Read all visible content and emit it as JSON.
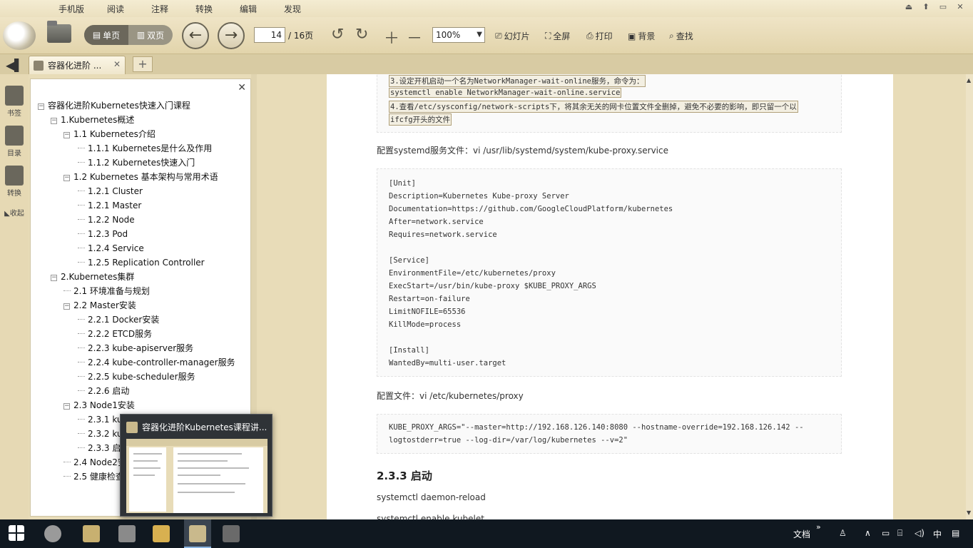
{
  "menu": [
    "手机版",
    "阅读",
    "注释",
    "转换",
    "编辑",
    "发现"
  ],
  "window_controls": [
    "⏏",
    "⬆",
    "▭",
    "✕"
  ],
  "toolbar": {
    "single_page": "单页",
    "double_page": "双页",
    "page_current": "14",
    "page_total": "/ 16页",
    "zoom": "100%",
    "slideshow": "幻灯片",
    "fullscreen": "全屏",
    "print": "打印",
    "background": "背景",
    "find": "查找"
  },
  "tab": {
    "title": "容器化进阶 ...",
    "close": "✕",
    "add": "+"
  },
  "rail": {
    "bookmarks": "书签",
    "toc": "目录",
    "convert": "转换",
    "collapse": "◣收起"
  },
  "outline": {
    "close": "✕",
    "items": [
      {
        "level": 0,
        "label": "容器化进阶Kubernetes快速入门课程",
        "toggle": "−"
      },
      {
        "level": 1,
        "label": "1.Kubernetes概述",
        "toggle": "−"
      },
      {
        "level": 2,
        "label": "1.1 Kubernetes介绍",
        "toggle": "−"
      },
      {
        "level": 3,
        "label": "1.1.1 Kubernetes是什么及作用"
      },
      {
        "level": 3,
        "label": "1.1.2 Kubernetes快速入门"
      },
      {
        "level": 2,
        "label": "1.2 Kubernetes 基本架构与常用术语",
        "toggle": "−"
      },
      {
        "level": 3,
        "label": "1.2.1 Cluster"
      },
      {
        "level": 3,
        "label": "1.2.1 Master"
      },
      {
        "level": 3,
        "label": "1.2.2 Node"
      },
      {
        "level": 3,
        "label": "1.2.3 Pod"
      },
      {
        "level": 3,
        "label": "1.2.4 Service"
      },
      {
        "level": 3,
        "label": "1.2.5 Replication Controller"
      },
      {
        "level": 1,
        "label": "2.Kubernetes集群",
        "toggle": "−"
      },
      {
        "level": 2,
        "label": "2.1 环境准备与规划"
      },
      {
        "level": 2,
        "label": "2.2 Master安装",
        "toggle": "−"
      },
      {
        "level": 3,
        "label": "2.2.1 Docker安装"
      },
      {
        "level": 3,
        "label": "2.2.2 ETCD服务"
      },
      {
        "level": 3,
        "label": "2.2.3 kube-apiserver服务"
      },
      {
        "level": 3,
        "label": "2.2.4 kube-controller-manager服务"
      },
      {
        "level": 3,
        "label": "2.2.5 kube-scheduler服务"
      },
      {
        "level": 3,
        "label": "2.2.6 启动"
      },
      {
        "level": 2,
        "label": "2.3 Node1安装",
        "toggle": "−"
      },
      {
        "level": 3,
        "label": "2.3.1 ku"
      },
      {
        "level": 3,
        "label": "2.3.2 ku"
      },
      {
        "level": 3,
        "label": "2.3.3 启"
      },
      {
        "level": 2,
        "label": "2.4 Node2安"
      },
      {
        "level": 2,
        "label": "2.5 健康检查"
      }
    ]
  },
  "document": {
    "top_code_lines": [
      "3.设定开机启动一个名为NetworkManager-wait-online服务，命令为：",
      "systemctl enable NetworkManager-wait-online.service",
      "4.查看/etc/sysconfig/network-scripts下，将其余无关的网卡位置文件全删掉，避免不必要的影响，即只留一个以",
      "ifcfg开头的文件"
    ],
    "para1": "配置systemd服务文件：vi /usr/lib/systemd/system/kube-proxy.service",
    "service_code": [
      "[Unit]",
      "Description=Kubernetes Kube-proxy Server",
      "Documentation=https://github.com/GoogleCloudPlatform/kubernetes",
      "After=network.service",
      "Requires=network.service",
      "",
      "[Service]",
      "EnvironmentFile=/etc/kubernetes/proxy",
      "ExecStart=/usr/bin/kube-proxy $KUBE_PROXY_ARGS",
      "Restart=on-failure",
      "LimitNOFILE=65536",
      "KillMode=process",
      "",
      "[Install]",
      "WantedBy=multi-user.target"
    ],
    "para2": "配置文件：vi /etc/kubernetes/proxy",
    "proxy_code": [
      "KUBE_PROXY_ARGS=\"--master=http://192.168.126.140:8080 --hostname-override=192.168.126.142 --",
      "logtostderr=true --log-dir=/var/log/kubernetes --v=2\""
    ],
    "heading": "2.3.3 启动",
    "cmd1": "systemctl daemon-reload",
    "cmd2": "systemctl enable kubelet"
  },
  "thumbnail": {
    "title": "容器化进阶Kubernetes课程讲..."
  },
  "taskbar": {
    "wen_dang": "文档",
    "ime": "中",
    "chevron": "»"
  }
}
